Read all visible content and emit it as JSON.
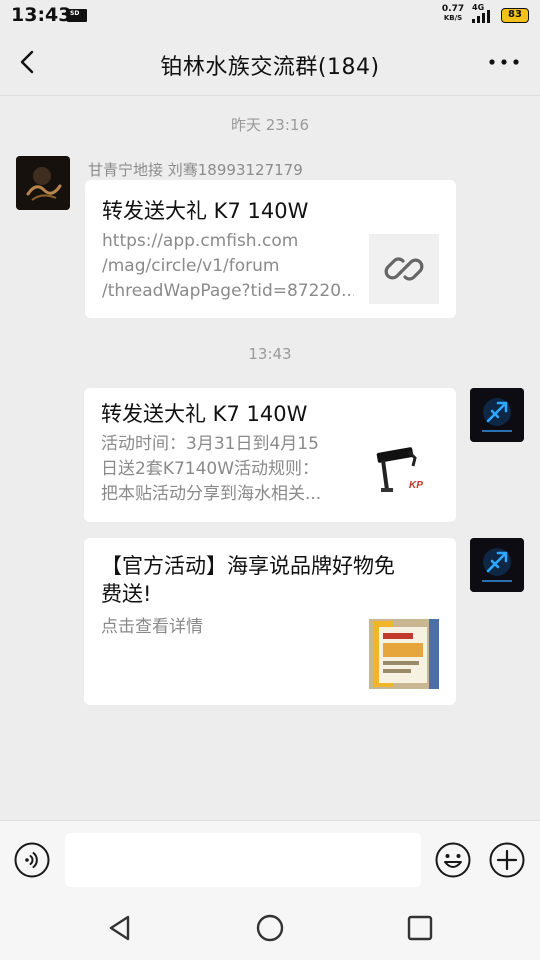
{
  "status_bar": {
    "time": "13:43",
    "net_speed": "0.77",
    "net_unit": "KB/S",
    "network": "4G",
    "battery": "83"
  },
  "header": {
    "title": "铂林水族交流群(184)"
  },
  "messages": [
    {
      "timestamp": "昨天 23:16",
      "sender": "甘青宁地接 刘骞18993127179",
      "title": "转发送大礼 K7 140W",
      "desc_lines": [
        "https://app.cmfish.com",
        "/mag/circle/v1/forum",
        "/threadWapPage?tid=87220..."
      ],
      "thumb_icon": "link-icon"
    },
    {
      "timestamp": "13:43",
      "title": "转发送大礼 K7 140W",
      "desc_lines": [
        "活动时间：3月31日到4月15",
        "日送2套K7140W活动规则：",
        "把本贴活动分享到海水相关..."
      ],
      "thumb_icon": "lamp-product-image"
    },
    {
      "title_lines": [
        "【官方活动】海享说品牌好物免",
        "费送!"
      ],
      "desc_lines": [
        "点击查看详情"
      ],
      "thumb_icon": "product-photo-image"
    }
  ],
  "colors": {
    "background": "#ededed",
    "bubble": "#ffffff",
    "muted_text": "#8a8a8a",
    "battery": "#f5c21b"
  }
}
